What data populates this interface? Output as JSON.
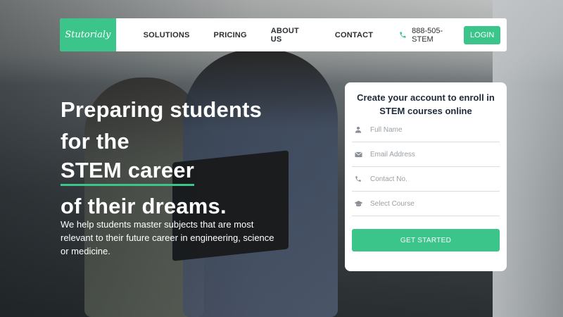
{
  "brand": {
    "logo_text": "Stutorialy",
    "accent": "#3cc58a"
  },
  "nav": {
    "links": [
      "SOLUTIONS",
      "PRICING",
      "ABOUT US",
      "CONTACT"
    ],
    "phone": "888-505-STEM",
    "login": "LOGIN"
  },
  "hero": {
    "lines": [
      "Preparing students",
      "for the",
      "STEM career",
      "of their dreams."
    ],
    "subtitle": "We help students master subjects that are most relevant to their future career in engineering, science or medicine."
  },
  "form": {
    "title": "Create your account to enroll in STEM courses online",
    "fields": [
      {
        "placeholder": "Full Name",
        "icon": "user-icon"
      },
      {
        "placeholder": "Email Address",
        "icon": "envelope-icon"
      },
      {
        "placeholder": "Contact No.",
        "icon": "phone-icon"
      },
      {
        "placeholder": "Select Course",
        "icon": "graduation-cap-icon"
      }
    ],
    "submit": "GET STARTED"
  }
}
